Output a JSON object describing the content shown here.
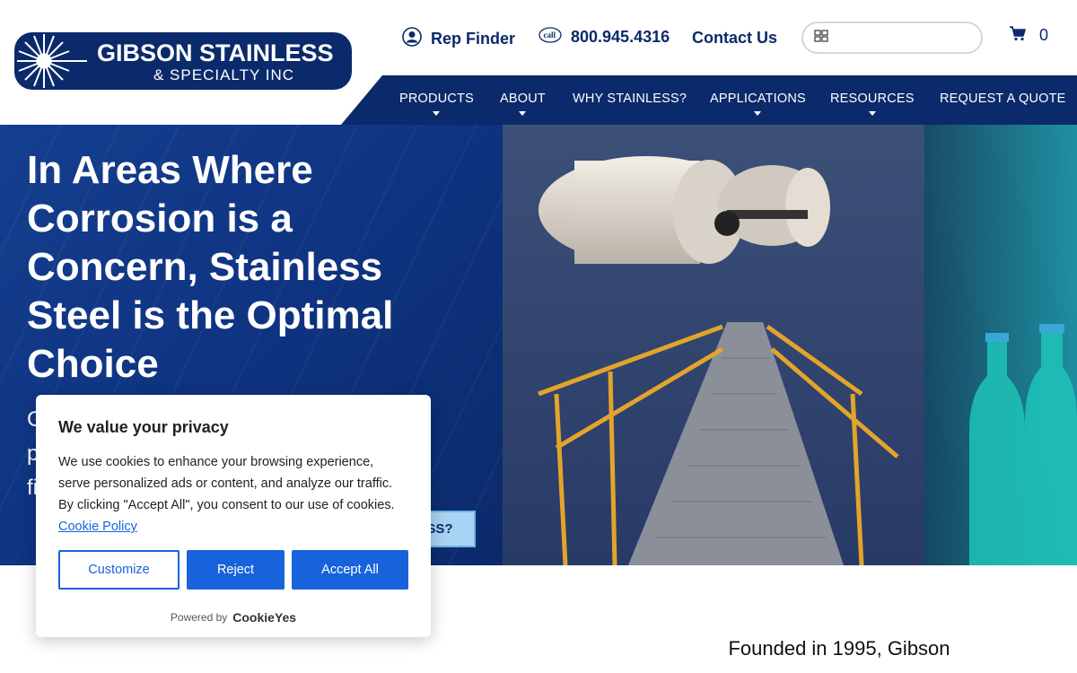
{
  "brand": {
    "name_line1": "GIBSON STAINLESS",
    "name_line2": "& SPECIALTY INC",
    "colors": {
      "navy": "#0b2a6b",
      "hero_button": "#a9d3f2",
      "cookie_blue": "#1863dc"
    }
  },
  "topbar": {
    "rep_finder": "Rep Finder",
    "phone_icon_text": "call",
    "phone": "800.945.4316",
    "contact": "Contact Us",
    "search_placeholder": "",
    "cart_count": "0"
  },
  "nav": {
    "items": [
      {
        "label": "PRODUCTS",
        "has_dropdown": true
      },
      {
        "label": "ABOUT",
        "has_dropdown": true
      },
      {
        "label": "WHY STAINLESS?",
        "has_dropdown": false
      },
      {
        "label": "APPLICATIONS",
        "has_dropdown": true
      },
      {
        "label": "RESOURCES",
        "has_dropdown": true
      },
      {
        "label": "REQUEST A QUOTE",
        "has_dropdown": false
      }
    ]
  },
  "hero": {
    "title": "In Areas Where Corrosion is a Concern, Stainless Steel is the Optimal Choice",
    "subtitle_visible": "G\np\nfi",
    "button_partial": "SS?"
  },
  "intro": {
    "line1": "Founded in 1995, Gibson"
  },
  "cookie": {
    "title": "We value your privacy",
    "body": "We use cookies to enhance your browsing experience, serve personalized ads or content, and analyze our traffic. By clicking \"Accept All\", you consent to our use of cookies.",
    "policy_link": "Cookie Policy",
    "customize": "Customize",
    "reject": "Reject",
    "accept": "Accept All",
    "powered_by": "Powered by",
    "powered_brand": "CookieYes"
  }
}
